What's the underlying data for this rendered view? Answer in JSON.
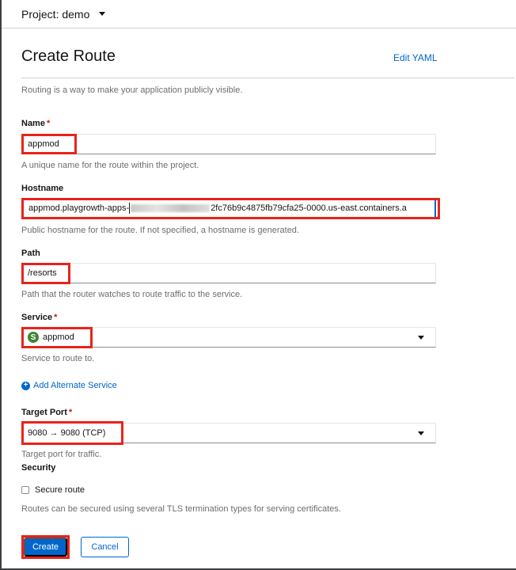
{
  "project": {
    "label": "Project: demo"
  },
  "page": {
    "title": "Create Route",
    "edit_yaml": "Edit YAML",
    "intro": "Routing is a way to make your application publicly visible."
  },
  "form": {
    "name": {
      "label": "Name",
      "required": "*",
      "value": "appmod",
      "help": "A unique name for the route within the project."
    },
    "hostname": {
      "label": "Hostname",
      "value_prefix": "appmod.playgrowth-apps-",
      "value_suffix": "2fc76b9c4875fb79cfa25-0000.us-east.containers.a",
      "help": "Public hostname for the route. If not specified, a hostname is generated."
    },
    "path": {
      "label": "Path",
      "value": "/resorts",
      "help": "Path that the router watches to route traffic to the service."
    },
    "service": {
      "label": "Service",
      "required": "*",
      "badge": "S",
      "value": "appmod",
      "help": "Service to route to."
    },
    "add_alternate": "Add Alternate Service",
    "target_port": {
      "label": "Target Port",
      "required": "*",
      "value": "9080 → 9080 (TCP)",
      "help": "Target port for traffic."
    },
    "security": {
      "label": "Security",
      "checkbox_label": "Secure route",
      "help": "Routes can be secured using several TLS termination types for serving certificates."
    }
  },
  "actions": {
    "create": "Create",
    "cancel": "Cancel"
  },
  "colors": {
    "link": "#0066cc",
    "highlight": "#e8231b",
    "service_badge": "#3e8635"
  }
}
